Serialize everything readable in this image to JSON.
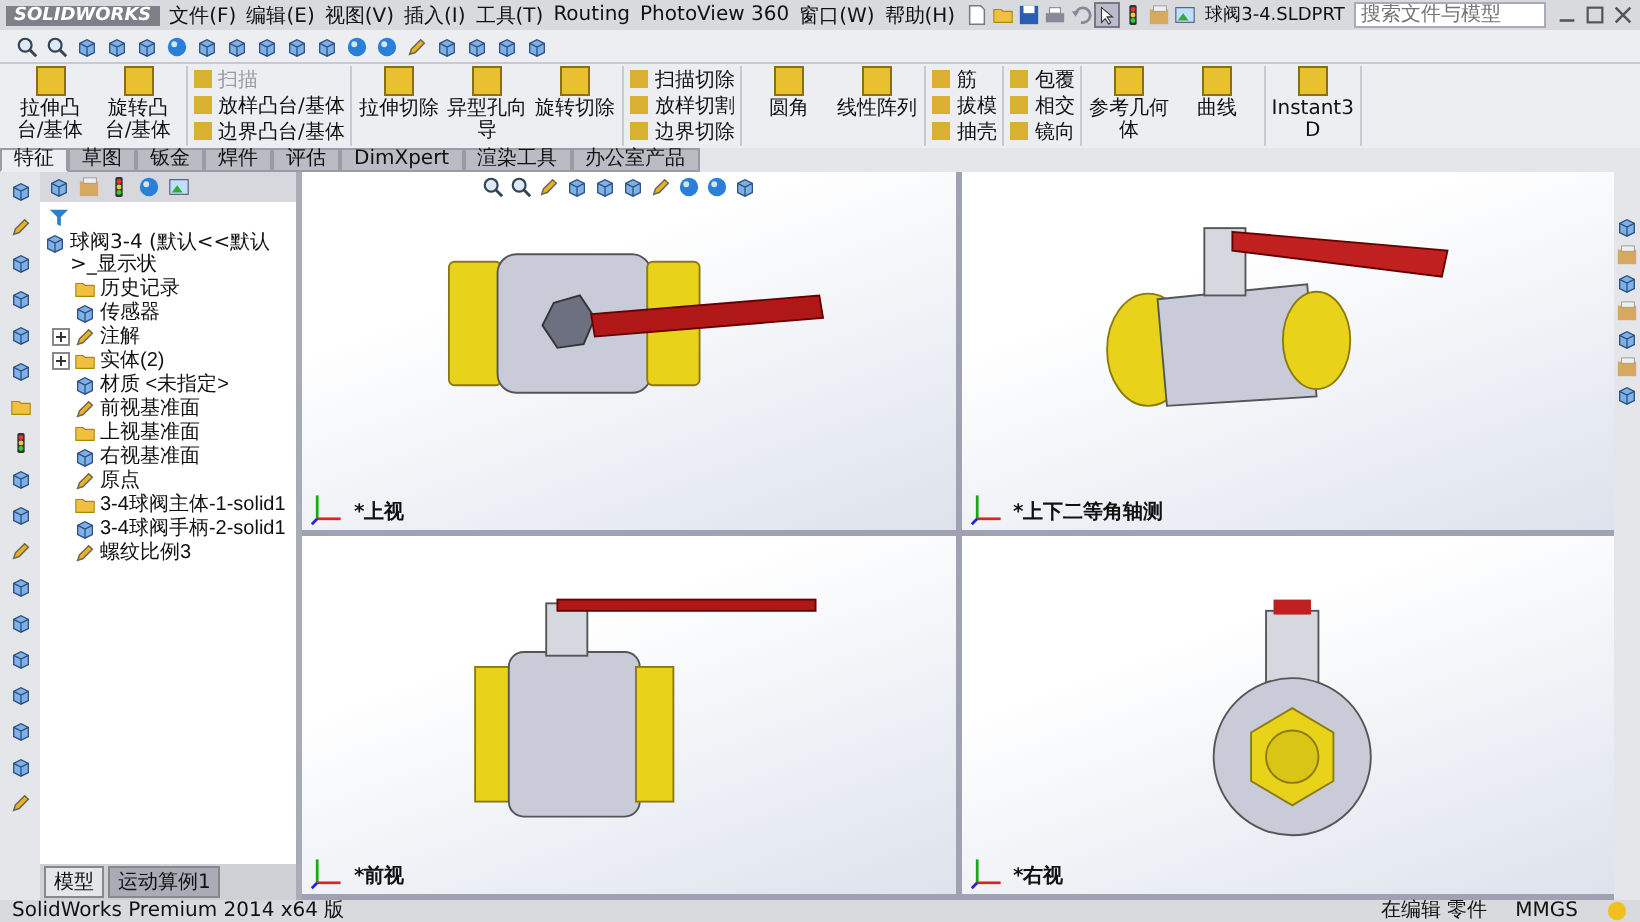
{
  "window": {
    "logo": "SOLIDWORKS",
    "title": "球阀3-4.SLDPRT"
  },
  "menu": [
    "文件(F)",
    "编辑(E)",
    "视图(V)",
    "插入(I)",
    "工具(T)",
    "Routing",
    "PhotoView 360",
    "窗口(W)",
    "帮助(H)"
  ],
  "search": {
    "placeholder": "搜索文件与模型"
  },
  "ribbon": [
    {
      "kind": "large",
      "commands": [
        {
          "label": "拉伸凸台/基体",
          "disabled": false
        },
        {
          "label": "旋转凸台/基体",
          "disabled": false
        }
      ]
    },
    {
      "kind": "small",
      "commands": [
        {
          "label": "扫描",
          "disabled": true
        },
        {
          "label": "放样凸台/基体",
          "disabled": false
        },
        {
          "label": "边界凸台/基体",
          "disabled": false
        }
      ]
    },
    {
      "kind": "large",
      "commands": [
        {
          "label": "拉伸切除",
          "disabled": false
        },
        {
          "label": "异型孔向导",
          "disabled": false
        },
        {
          "label": "旋转切除",
          "disabled": false
        }
      ]
    },
    {
      "kind": "small",
      "commands": [
        {
          "label": "扫描切除",
          "disabled": false
        },
        {
          "label": "放样切割",
          "disabled": false
        },
        {
          "label": "边界切除",
          "disabled": false
        }
      ]
    },
    {
      "kind": "large",
      "commands": [
        {
          "label": "圆角",
          "disabled": false
        },
        {
          "label": "线性阵列",
          "disabled": false
        }
      ]
    },
    {
      "kind": "small",
      "commands": [
        {
          "label": "筋",
          "disabled": false
        },
        {
          "label": "拔模",
          "disabled": false
        },
        {
          "label": "抽壳",
          "disabled": false
        }
      ]
    },
    {
      "kind": "small",
      "commands": [
        {
          "label": "包覆",
          "disabled": false
        },
        {
          "label": "相交",
          "disabled": false
        },
        {
          "label": "镜向",
          "disabled": false
        }
      ]
    },
    {
      "kind": "large",
      "commands": [
        {
          "label": "参考几何体",
          "disabled": false
        },
        {
          "label": "曲线",
          "disabled": false
        }
      ]
    },
    {
      "kind": "large",
      "commands": [
        {
          "label": "Instant3D",
          "disabled": false
        }
      ]
    }
  ],
  "command_tabs": [
    {
      "label": "特征",
      "selected": true
    },
    {
      "label": "草图",
      "selected": false
    },
    {
      "label": "钣金",
      "selected": false
    },
    {
      "label": "焊件",
      "selected": false
    },
    {
      "label": "评估",
      "selected": false
    },
    {
      "label": "DimXpert",
      "selected": false
    },
    {
      "label": "渲染工具",
      "selected": false
    },
    {
      "label": "办公室产品",
      "selected": false
    }
  ],
  "feature_tree": {
    "root": "球阀3-4 (默认<<默认>_显示状",
    "items": [
      {
        "label": "历史记录",
        "expandable": false
      },
      {
        "label": "传感器",
        "expandable": false
      },
      {
        "label": "注解",
        "expandable": true
      },
      {
        "label": "实体(2)",
        "expandable": true
      },
      {
        "label": "材质 <未指定>",
        "expandable": false
      },
      {
        "label": "前视基准面",
        "expandable": false
      },
      {
        "label": "上视基准面",
        "expandable": false
      },
      {
        "label": "右视基准面",
        "expandable": false
      },
      {
        "label": "原点",
        "expandable": false
      },
      {
        "label": "3-4球阀主体-1-solid1",
        "expandable": false
      },
      {
        "label": "3-4球阀手柄-2-solid1",
        "expandable": false
      },
      {
        "label": "螺纹比例3",
        "expandable": false
      }
    ]
  },
  "panel_tabs": [
    {
      "label": "模型",
      "selected": true
    },
    {
      "label": "运动算例1",
      "selected": false
    }
  ],
  "viewports": [
    {
      "label": "*上视",
      "kind": "top"
    },
    {
      "label": "*上下二等角轴测",
      "kind": "iso"
    },
    {
      "label": "*前视",
      "kind": "front"
    },
    {
      "label": "*右视",
      "kind": "right"
    }
  ],
  "status_bar": {
    "product": "SolidWorks Premium 2014 x64 版",
    "mode": "在编辑 零件",
    "units": "MMGS"
  }
}
